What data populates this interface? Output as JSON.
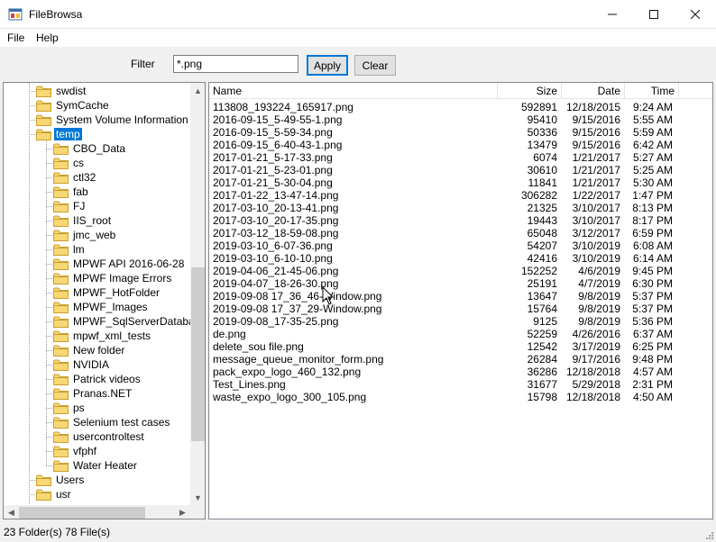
{
  "window": {
    "title": "FileBrowsa",
    "minimize_glyph": "—",
    "maximize_glyph": "☐",
    "close_glyph": "✕"
  },
  "menu": {
    "file": "File",
    "help": "Help"
  },
  "toolbar": {
    "filter_label": "Filter",
    "filter_value": "*.png",
    "apply_label": "Apply",
    "clear_label": "Clear"
  },
  "tree": {
    "items": [
      {
        "label": "swdist",
        "level": 1
      },
      {
        "label": "SymCache",
        "level": 1
      },
      {
        "label": "System Volume Information",
        "level": 1
      },
      {
        "label": "temp",
        "level": 1,
        "selected": true
      },
      {
        "label": "CBO_Data",
        "level": 2
      },
      {
        "label": "cs",
        "level": 2
      },
      {
        "label": "ctl32",
        "level": 2
      },
      {
        "label": "fab",
        "level": 2
      },
      {
        "label": "FJ",
        "level": 2
      },
      {
        "label": "IIS_root",
        "level": 2
      },
      {
        "label": "jmc_web",
        "level": 2
      },
      {
        "label": "lm",
        "level": 2
      },
      {
        "label": "MPWF API 2016-06-28",
        "level": 2
      },
      {
        "label": "MPWF Image Errors",
        "level": 2
      },
      {
        "label": "MPWF_HotFolder",
        "level": 2
      },
      {
        "label": "MPWF_Images",
        "level": 2
      },
      {
        "label": "MPWF_SqlServerDatabase",
        "level": 2
      },
      {
        "label": "mpwf_xml_tests",
        "level": 2
      },
      {
        "label": "New folder",
        "level": 2
      },
      {
        "label": "NVIDIA",
        "level": 2
      },
      {
        "label": "Patrick videos",
        "level": 2
      },
      {
        "label": "Pranas.NET",
        "level": 2
      },
      {
        "label": "ps",
        "level": 2
      },
      {
        "label": "Selenium test cases",
        "level": 2
      },
      {
        "label": "usercontroltest",
        "level": 2
      },
      {
        "label": "vfphf",
        "level": 2
      },
      {
        "label": "Water Heater",
        "level": 2
      },
      {
        "label": "Users",
        "level": 1
      },
      {
        "label": "usr",
        "level": 1
      }
    ]
  },
  "files": {
    "columns": {
      "name": "Name",
      "size": "Size",
      "date": "Date",
      "time": "Time"
    },
    "rows": [
      {
        "name": "113808_193224_165917.png",
        "size": "592891",
        "date": "12/18/2015",
        "time": "9:24 AM"
      },
      {
        "name": "2016-09-15_5-49-55-1.png",
        "size": "95410",
        "date": "9/15/2016",
        "time": "5:55 AM"
      },
      {
        "name": "2016-09-15_5-59-34.png",
        "size": "50336",
        "date": "9/15/2016",
        "time": "5:59 AM"
      },
      {
        "name": "2016-09-15_6-40-43-1.png",
        "size": "13479",
        "date": "9/15/2016",
        "time": "6:42 AM"
      },
      {
        "name": "2017-01-21_5-17-33.png",
        "size": "6074",
        "date": "1/21/2017",
        "time": "5:27 AM"
      },
      {
        "name": "2017-01-21_5-23-01.png",
        "size": "30610",
        "date": "1/21/2017",
        "time": "5:25 AM"
      },
      {
        "name": "2017-01-21_5-30-04.png",
        "size": "11841",
        "date": "1/21/2017",
        "time": "5:30 AM"
      },
      {
        "name": "2017-01-22_13-47-14.png",
        "size": "306282",
        "date": "1/22/2017",
        "time": "1:47 PM"
      },
      {
        "name": "2017-03-10_20-13-41.png",
        "size": "21325",
        "date": "3/10/2017",
        "time": "8:13 PM"
      },
      {
        "name": "2017-03-10_20-17-35.png",
        "size": "19443",
        "date": "3/10/2017",
        "time": "8:17 PM"
      },
      {
        "name": "2017-03-12_18-59-08.png",
        "size": "65048",
        "date": "3/12/2017",
        "time": "6:59 PM"
      },
      {
        "name": "2019-03-10_6-07-36.png",
        "size": "54207",
        "date": "3/10/2019",
        "time": "6:08 AM"
      },
      {
        "name": "2019-03-10_6-10-10.png",
        "size": "42416",
        "date": "3/10/2019",
        "time": "6:14 AM"
      },
      {
        "name": "2019-04-06_21-45-06.png",
        "size": "152252",
        "date": "4/6/2019",
        "time": "9:45 PM"
      },
      {
        "name": "2019-04-07_18-26-30.png",
        "size": "25191",
        "date": "4/7/2019",
        "time": "6:30 PM"
      },
      {
        "name": "2019-09-08 17_36_46-Window.png",
        "size": "13647",
        "date": "9/8/2019",
        "time": "5:37 PM"
      },
      {
        "name": "2019-09-08 17_37_29-Window.png",
        "size": "15764",
        "date": "9/8/2019",
        "time": "5:37 PM"
      },
      {
        "name": "2019-09-08_17-35-25.png",
        "size": "9125",
        "date": "9/8/2019",
        "time": "5:36 PM"
      },
      {
        "name": "de.png",
        "size": "52259",
        "date": "4/26/2016",
        "time": "6:37 AM"
      },
      {
        "name": "delete_sou file.png",
        "size": "12542",
        "date": "3/17/2019",
        "time": "6:25 PM"
      },
      {
        "name": "message_queue_monitor_form.png",
        "size": "26284",
        "date": "9/17/2016",
        "time": "9:48 PM"
      },
      {
        "name": "pack_expo_logo_460_132.png",
        "size": "36286",
        "date": "12/18/2018",
        "time": "4:57 AM"
      },
      {
        "name": "Test_Lines.png",
        "size": "31677",
        "date": "5/29/2018",
        "time": "2:31 PM"
      },
      {
        "name": "waste_expo_logo_300_105.png",
        "size": "15798",
        "date": "12/18/2018",
        "time": "4:50 AM"
      }
    ]
  },
  "status": {
    "text": "23 Folder(s)  78 File(s)"
  },
  "colors": {
    "selection": "#0078d7",
    "folder_fill": "#f8d775",
    "folder_stroke": "#c9a030"
  }
}
